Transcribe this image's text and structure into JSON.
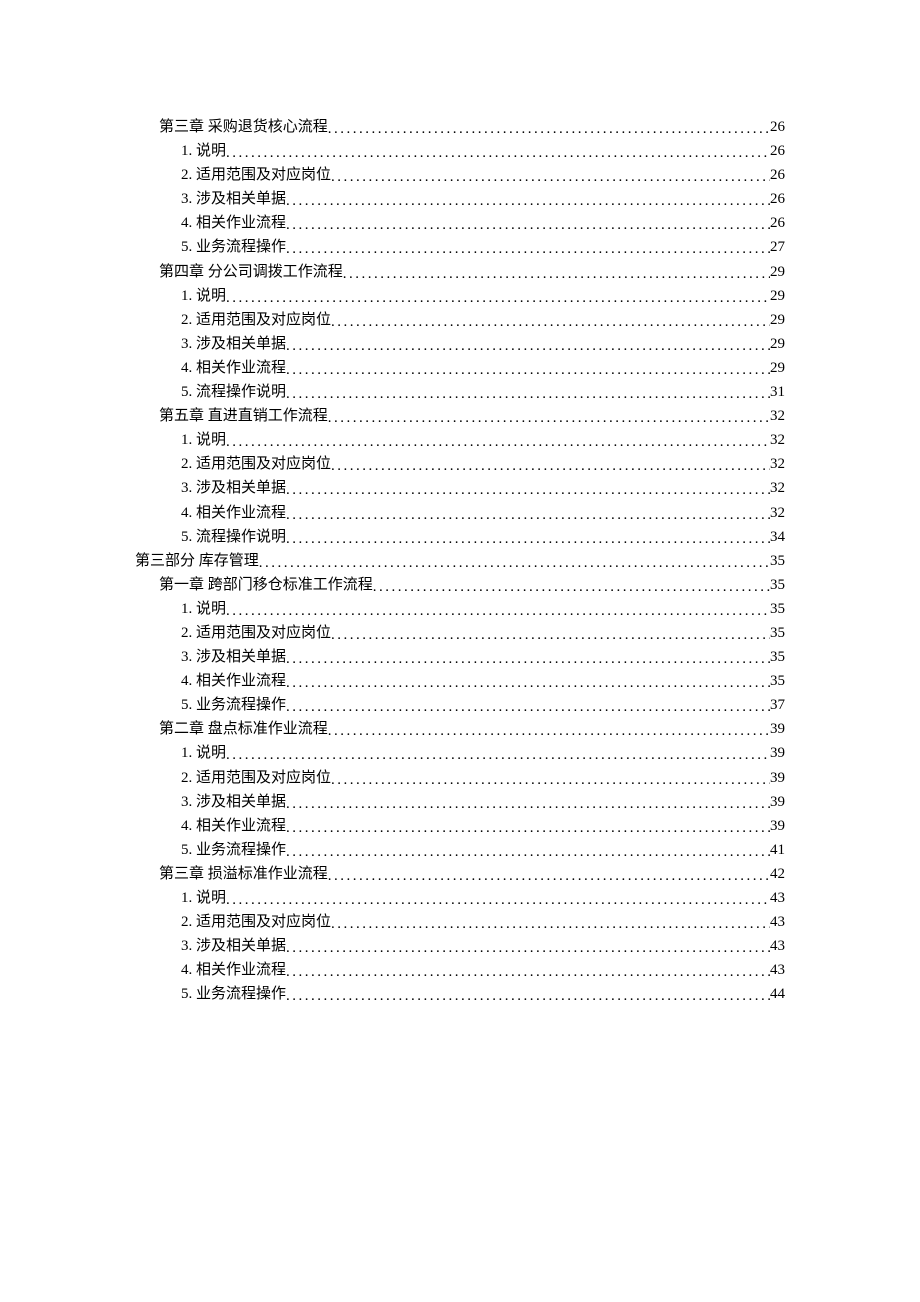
{
  "toc": [
    {
      "level": 2,
      "text": "第三章  采购退货核心流程",
      "page": "26"
    },
    {
      "level": 3,
      "text": "1.  说明",
      "page": "26"
    },
    {
      "level": 3,
      "text": "2.  适用范围及对应岗位",
      "page": "26"
    },
    {
      "level": 3,
      "text": "3.  涉及相关单据",
      "page": "26"
    },
    {
      "level": 3,
      "text": "4.  相关作业流程",
      "page": "26"
    },
    {
      "level": 3,
      "text": "5.  业务流程操作",
      "page": "27"
    },
    {
      "level": 2,
      "text": "第四章  分公司调拨工作流程",
      "page": "29"
    },
    {
      "level": 3,
      "text": "1.  说明",
      "page": "29"
    },
    {
      "level": 3,
      "text": "2.  适用范围及对应岗位",
      "page": "29"
    },
    {
      "level": 3,
      "text": "3.  涉及相关单据",
      "page": "29"
    },
    {
      "level": 3,
      "text": "4.  相关作业流程",
      "page": "29"
    },
    {
      "level": 3,
      "text": "5.  流程操作说明",
      "page": "31"
    },
    {
      "level": 2,
      "text": "第五章  直进直销工作流程",
      "page": "32"
    },
    {
      "level": 3,
      "text": "1.  说明",
      "page": "32"
    },
    {
      "level": 3,
      "text": "2.  适用范围及对应岗位",
      "page": "32"
    },
    {
      "level": 3,
      "text": "3.  涉及相关单据",
      "page": "32"
    },
    {
      "level": 3,
      "text": "4.  相关作业流程",
      "page": "32"
    },
    {
      "level": 3,
      "text": "5.  流程操作说明",
      "page": "34"
    },
    {
      "level": 1,
      "text": "第三部分 库存管理",
      "page": "35"
    },
    {
      "level": 2,
      "text": "第一章  跨部门移仓标准工作流程",
      "page": "35"
    },
    {
      "level": 3,
      "text": "1.  说明",
      "page": "35"
    },
    {
      "level": 3,
      "text": "2.  适用范围及对应岗位",
      "page": "35"
    },
    {
      "level": 3,
      "text": "3.  涉及相关单据",
      "page": "35"
    },
    {
      "level": 3,
      "text": "4.  相关作业流程",
      "page": "35"
    },
    {
      "level": 3,
      "text": "5.  业务流程操作",
      "page": "37"
    },
    {
      "level": 2,
      "text": "第二章  盘点标准作业流程",
      "page": "39"
    },
    {
      "level": 3,
      "text": "1.  说明",
      "page": "39"
    },
    {
      "level": 3,
      "text": "2.  适用范围及对应岗位",
      "page": "39"
    },
    {
      "level": 3,
      "text": "3.  涉及相关单据",
      "page": "39"
    },
    {
      "level": 3,
      "text": "4.  相关作业流程",
      "page": "39"
    },
    {
      "level": 3,
      "text": "5.  业务流程操作",
      "page": "41"
    },
    {
      "level": 2,
      "text": "第三章  损溢标准作业流程",
      "page": "42"
    },
    {
      "level": 3,
      "text": "1.  说明",
      "page": "43"
    },
    {
      "level": 3,
      "text": "2.  适用范围及对应岗位",
      "page": "43"
    },
    {
      "level": 3,
      "text": "3.  涉及相关单据",
      "page": "43"
    },
    {
      "level": 3,
      "text": "4.  相关作业流程",
      "page": "43"
    },
    {
      "level": 3,
      "text": "5.  业务流程操作",
      "page": "44"
    }
  ]
}
